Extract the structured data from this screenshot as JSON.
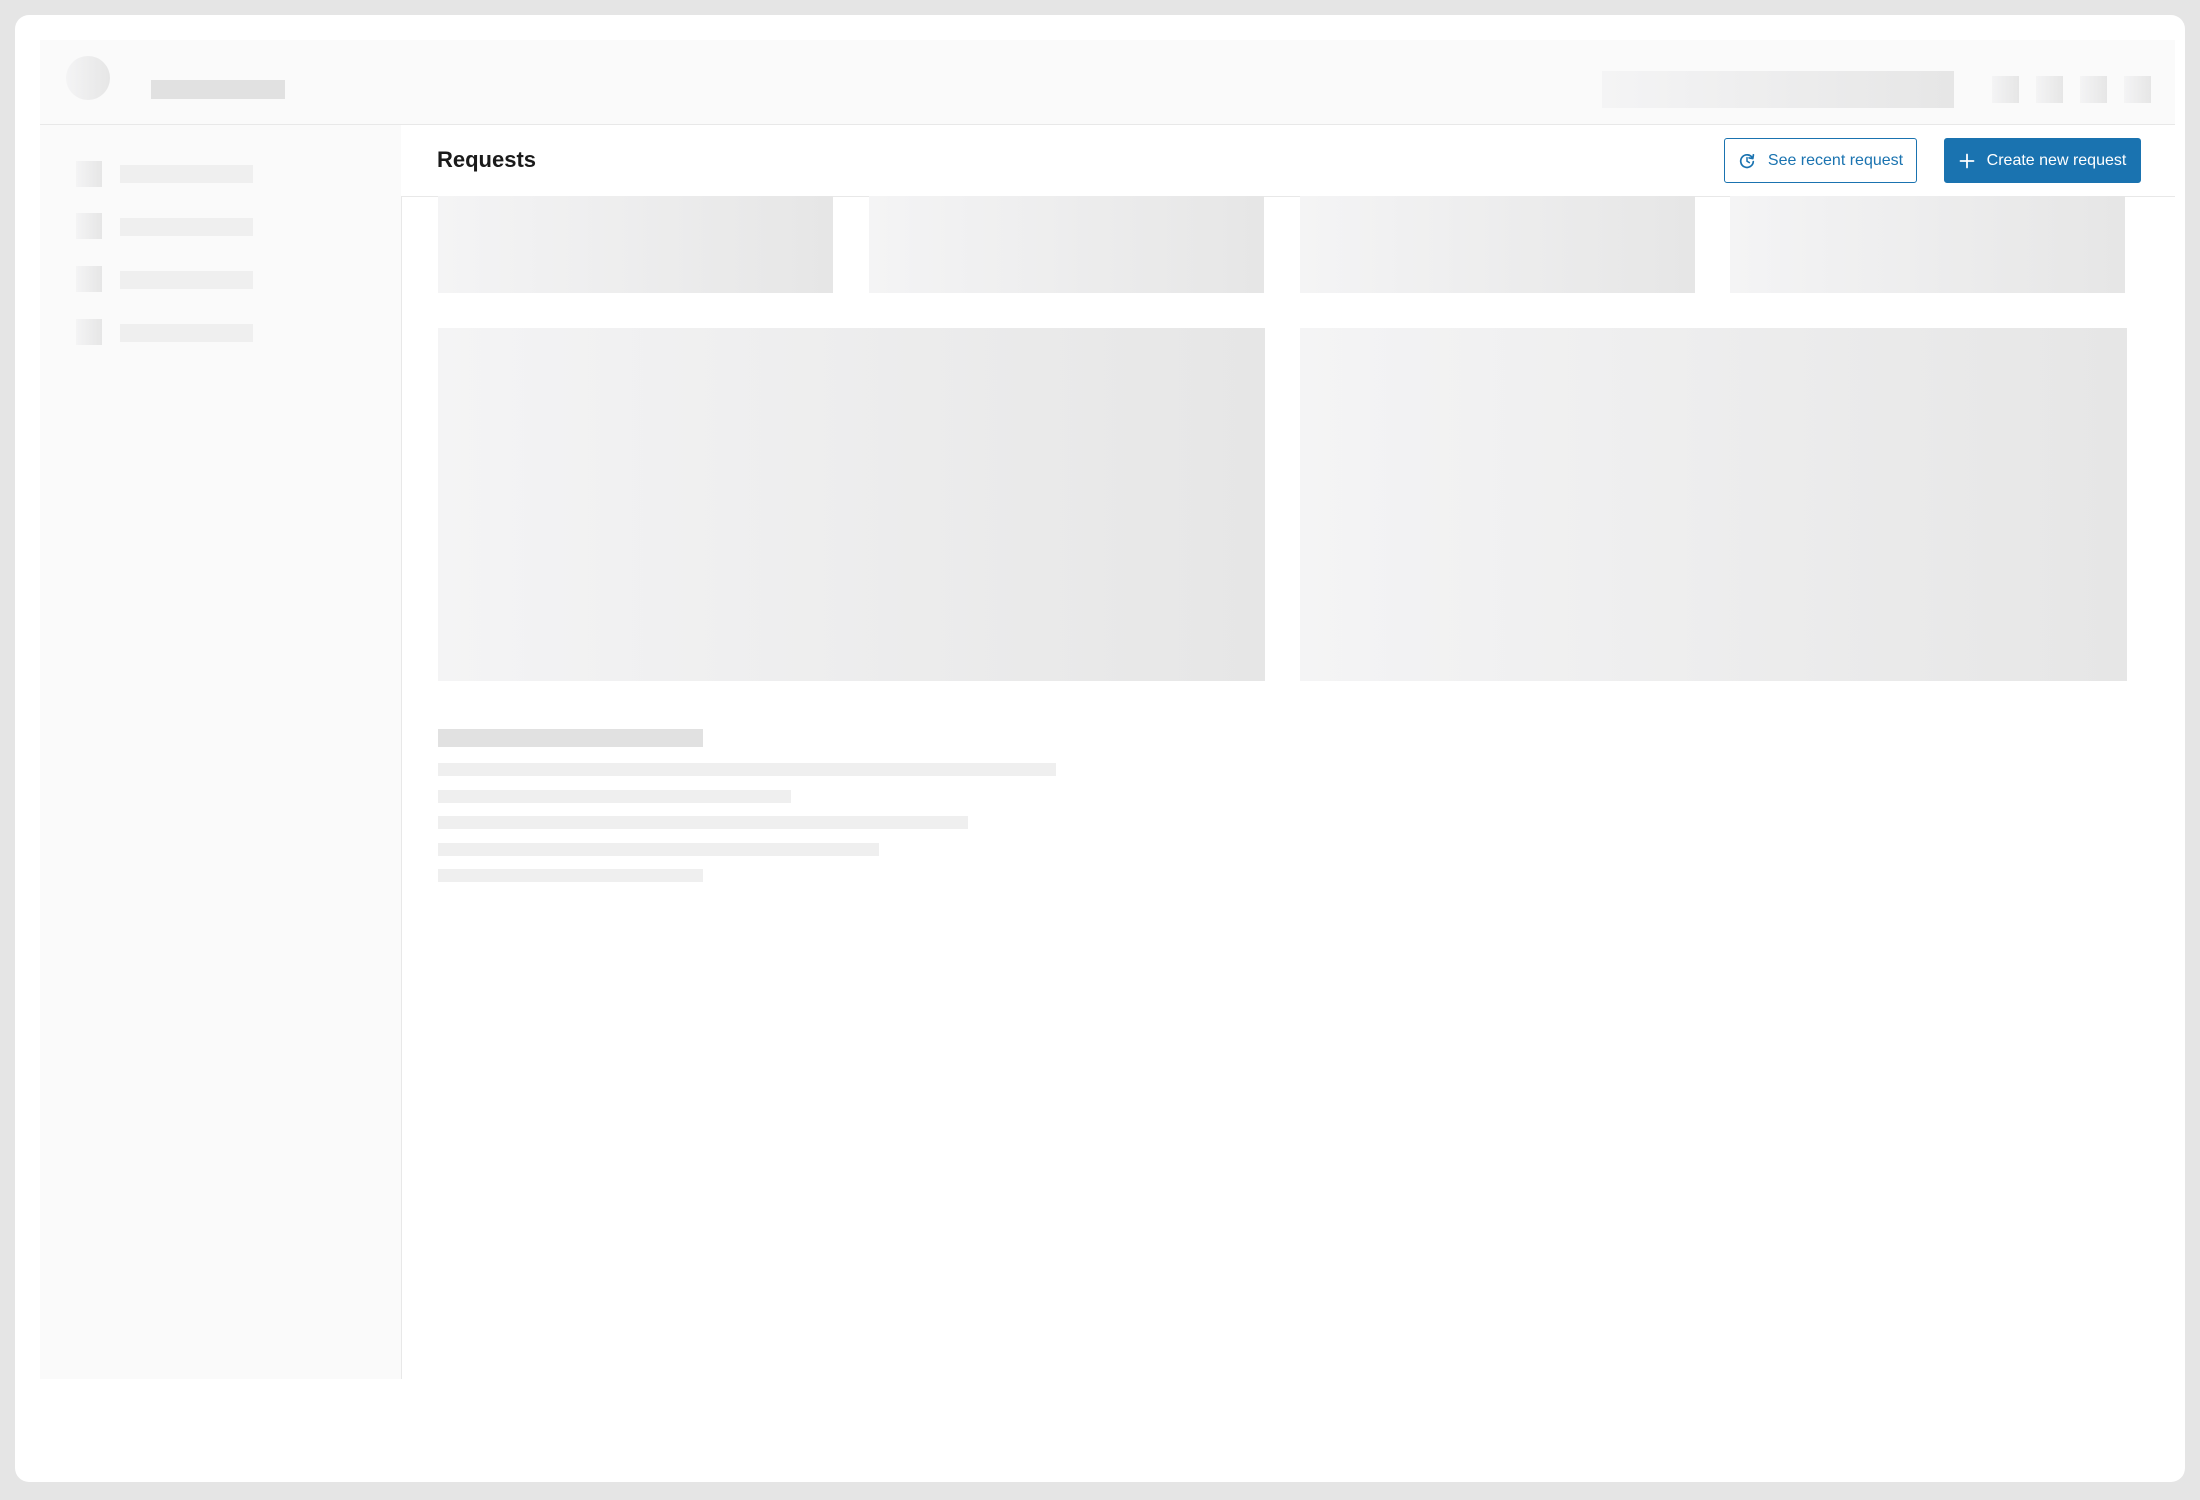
{
  "header": {
    "title": "Requests",
    "recent_button_label": "See recent request",
    "create_button_label": "Create new request",
    "recent_button_icon": "history-icon",
    "create_button_icon": "plus-icon"
  },
  "colors": {
    "accent": "#1a73b0",
    "frame": "#e5e5e5",
    "skeleton": "#e6e6e6"
  },
  "state": "loading-skeleton"
}
